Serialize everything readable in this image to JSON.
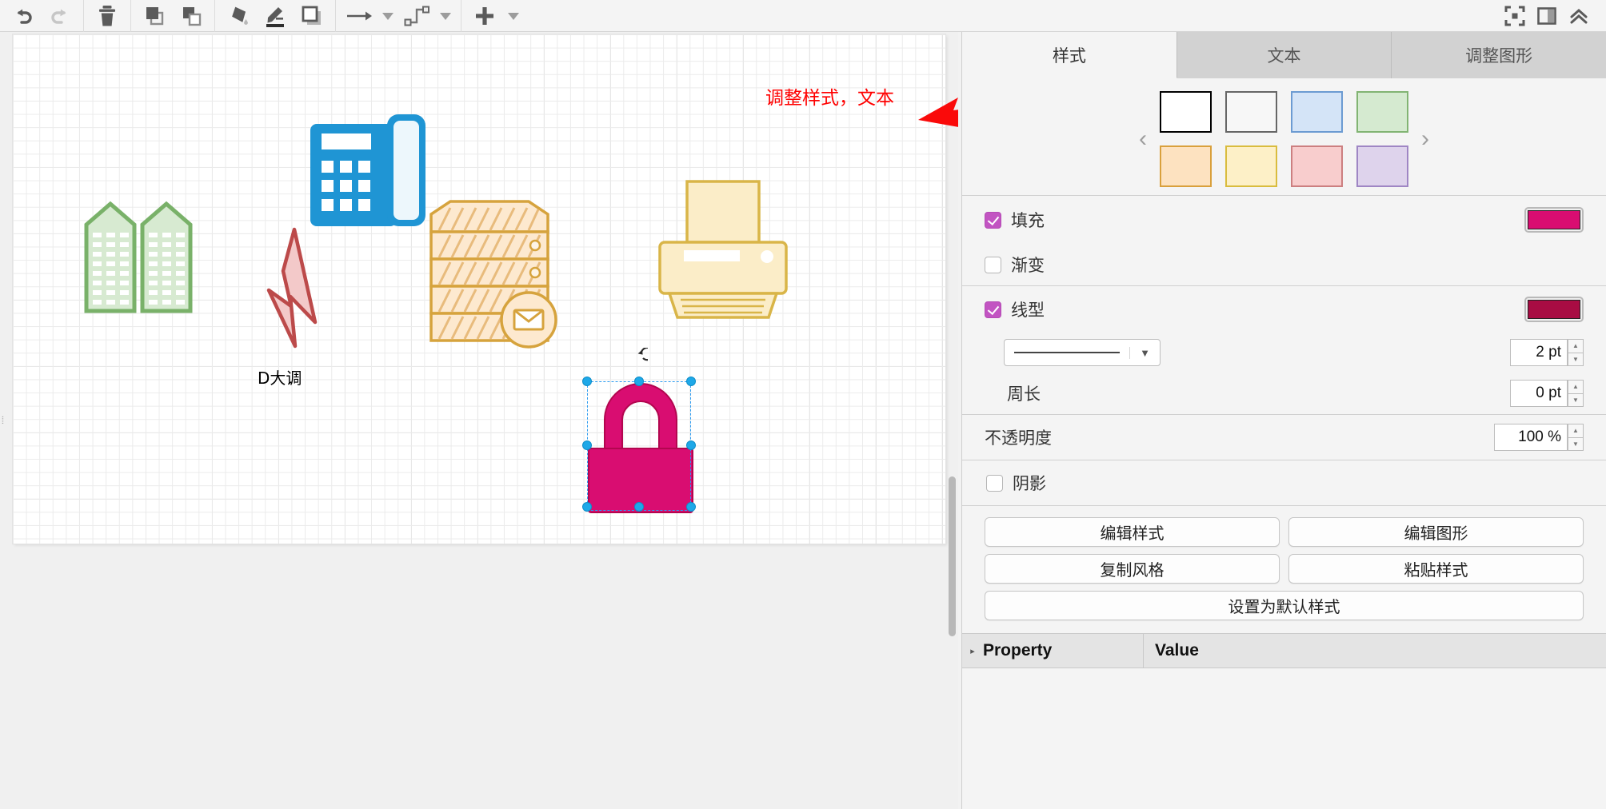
{
  "toolbar": {
    "groups": [
      {
        "buttons": [
          {
            "name": "undo-icon",
            "label": "撤销",
            "disabled": false
          },
          {
            "name": "redo-icon",
            "label": "重做",
            "disabled": true
          }
        ]
      },
      {
        "buttons": [
          {
            "name": "delete-icon",
            "label": "删除",
            "disabled": false
          }
        ]
      },
      {
        "buttons": [
          {
            "name": "bring-to-front-icon",
            "label": "置于顶层",
            "disabled": false
          },
          {
            "name": "send-to-back-icon",
            "label": "置于底层",
            "disabled": false
          }
        ]
      },
      {
        "buttons": [
          {
            "name": "fill-color-icon",
            "label": "填充颜色",
            "disabled": false
          },
          {
            "name": "line-color-icon",
            "label": "线条颜色",
            "disabled": false
          },
          {
            "name": "shadow-icon",
            "label": "阴影",
            "disabled": false
          }
        ]
      },
      {
        "buttons": [
          {
            "name": "arrow-style-icon",
            "label": "箭头样式",
            "disabled": false
          },
          {
            "name": "waypoint-style-icon",
            "label": "连线样式",
            "disabled": false
          }
        ]
      },
      {
        "buttons": [
          {
            "name": "insert-icon",
            "label": "插入",
            "disabled": false
          }
        ]
      }
    ],
    "right_buttons": [
      {
        "name": "fit-page-icon",
        "label": "适应页面"
      },
      {
        "name": "toggle-panel-icon",
        "label": "显示/隐藏面板"
      },
      {
        "name": "collapse-toolbar-icon",
        "label": "折叠工具栏"
      }
    ]
  },
  "canvas": {
    "annotation": "调整样式，文本",
    "annotation_color": "#ff0000",
    "shape_label": "D大调",
    "shapes": [
      {
        "name": "buildings-shape",
        "label": "建筑",
        "fill": "#d7ead1",
        "stroke": "#79b169"
      },
      {
        "name": "telephone-shape",
        "label": "电话",
        "fill": "#1f95d4",
        "stroke": "#1f95d4"
      },
      {
        "name": "lightning-shape",
        "label": "闪电",
        "fill": "#f3c9c9",
        "stroke": "#bc4a4a"
      },
      {
        "name": "mail-server-shape",
        "label": "邮件服务器",
        "fill": "#fde9cf",
        "stroke": "#d6a33d"
      },
      {
        "name": "printer-shape",
        "label": "打印机",
        "fill": "#fbedc8",
        "stroke": "#d9b548"
      },
      {
        "name": "lock-shape",
        "label": "锁",
        "fill": "#d90d71",
        "stroke": "#b3064f",
        "selected": true
      }
    ],
    "selection": {
      "rotate_handle": "rotate-handle",
      "handle_count": 8
    },
    "grip": "⦙"
  },
  "panel": {
    "tabs": [
      {
        "id": "style",
        "label": "样式",
        "active": true
      },
      {
        "id": "text",
        "label": "文本",
        "active": false
      },
      {
        "id": "arrange",
        "label": "调整图形",
        "active": false
      }
    ],
    "style_picker": {
      "prev_label": "‹",
      "next_label": "›",
      "swatches": [
        {
          "fill": "#ffffff",
          "stroke": "#000000"
        },
        {
          "fill": "#f7f7f7",
          "stroke": "#666666"
        },
        {
          "fill": "#d4e4f7",
          "stroke": "#6c9bd2"
        },
        {
          "fill": "#d5ead0",
          "stroke": "#82b473"
        },
        {
          "fill": "#fde2c0",
          "stroke": "#d9a03c"
        },
        {
          "fill": "#fdf0c7",
          "stroke": "#d9bc3e"
        },
        {
          "fill": "#f8cdcd",
          "stroke": "#cc7f80"
        },
        {
          "fill": "#ded3ec",
          "stroke": "#9f86c4"
        }
      ]
    },
    "fill": {
      "label": "填充",
      "checked": true,
      "color": "#d90d71"
    },
    "gradient": {
      "label": "渐变",
      "checked": false
    },
    "line": {
      "label": "线型",
      "checked": true,
      "color": "#a80c43",
      "style_preview": "solid",
      "width_value": "2 pt",
      "perimeter_label": "周长",
      "perimeter_value": "0 pt"
    },
    "opacity": {
      "label": "不透明度",
      "value": "100 %"
    },
    "shadow": {
      "label": "阴影",
      "checked": false
    },
    "buttons": [
      {
        "name": "edit-style-button",
        "label": "编辑样式"
      },
      {
        "name": "edit-shape-button",
        "label": "编辑图形"
      },
      {
        "name": "copy-style-button",
        "label": "复制风格"
      },
      {
        "name": "paste-style-button",
        "label": "粘贴样式"
      },
      {
        "name": "set-default-style-button",
        "label": "设置为默认样式"
      }
    ],
    "properties_table": {
      "expander": "▸",
      "columns": [
        "Property",
        "Value"
      ],
      "rows": []
    }
  }
}
